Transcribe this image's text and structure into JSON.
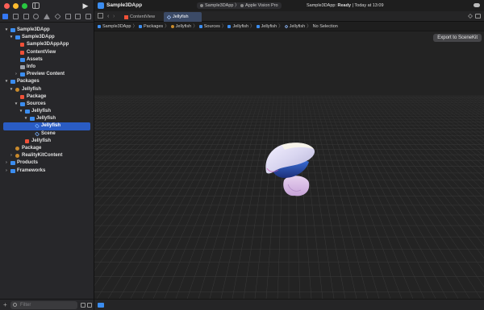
{
  "window": {
    "app_title": "Sample3DApp"
  },
  "scheme": {
    "target": "Sample3DApp",
    "separator": "〉",
    "device": "Apple Vision Pro"
  },
  "status": {
    "prefix": "Sample3DApp: ",
    "state": "Ready",
    "suffix": " | Today at 13:09"
  },
  "tabs": [
    {
      "label": "ContentView",
      "icon": "swift-file-icon"
    },
    {
      "label": "Jellyfish",
      "icon": "scene-cube-icon"
    }
  ],
  "jumpbar": {
    "crumbs": [
      "Sample3DApp",
      "Packages",
      "Jellyfish",
      "Sources",
      "Jellyfish",
      "Jellyfish",
      "Jellyfish",
      "No Selection"
    ],
    "separator": "〉"
  },
  "navigator": {
    "items": [
      {
        "label": "Sample3DApp",
        "icon": "project-icon",
        "disclosure": "▾"
      },
      {
        "label": "Sample3DApp",
        "icon": "folder-icon",
        "disclosure": "▾"
      },
      {
        "label": "Sample3DAppApp",
        "icon": "swift-file-icon",
        "disclosure": ""
      },
      {
        "label": "ContentView",
        "icon": "swift-file-icon",
        "disclosure": ""
      },
      {
        "label": "Assets",
        "icon": "asset-catalog-icon",
        "disclosure": ""
      },
      {
        "label": "Info",
        "icon": "plist-icon",
        "disclosure": ""
      },
      {
        "label": "Preview Content",
        "icon": "folder-icon",
        "disclosure": "›"
      },
      {
        "label": "Packages",
        "icon": "folder-icon",
        "disclosure": "▾"
      },
      {
        "label": "Jellyfish",
        "icon": "package-icon",
        "disclosure": "▾"
      },
      {
        "label": "Package",
        "icon": "swift-file-icon",
        "disclosure": ""
      },
      {
        "label": "Sources",
        "icon": "folder-icon",
        "disclosure": "▾"
      },
      {
        "label": "Jellyfish",
        "icon": "folder-icon",
        "disclosure": "▾"
      },
      {
        "label": "Jellyfish",
        "icon": "reality-bundle-icon",
        "disclosure": "▾"
      },
      {
        "label": "Jellyfish",
        "icon": "scene-cube-icon",
        "disclosure": "",
        "selected": true
      },
      {
        "label": "Scene",
        "icon": "scene-cube-icon",
        "disclosure": ""
      },
      {
        "label": "Jellyfish",
        "icon": "swift-file-icon",
        "disclosure": ""
      },
      {
        "label": "Package",
        "icon": "package-icon",
        "disclosure": ""
      },
      {
        "label": "RealityKitContent",
        "icon": "package-icon",
        "disclosure": "›"
      },
      {
        "label": "Products",
        "icon": "folder-icon",
        "disclosure": "›"
      },
      {
        "label": "Frameworks",
        "icon": "folder-icon",
        "disclosure": "›"
      }
    ]
  },
  "filter": {
    "placeholder": "Filter",
    "add_label": "+"
  },
  "run_symbol": "▶",
  "nav_arrows": {
    "back": "‹",
    "forward": "›"
  },
  "export_button": "Export to SceneKit",
  "colors": {
    "accent": "#3478f6",
    "selection": "#2a5cc4",
    "swift": "#f05138",
    "folder": "#3b8df0",
    "package": "#c98a2c"
  }
}
